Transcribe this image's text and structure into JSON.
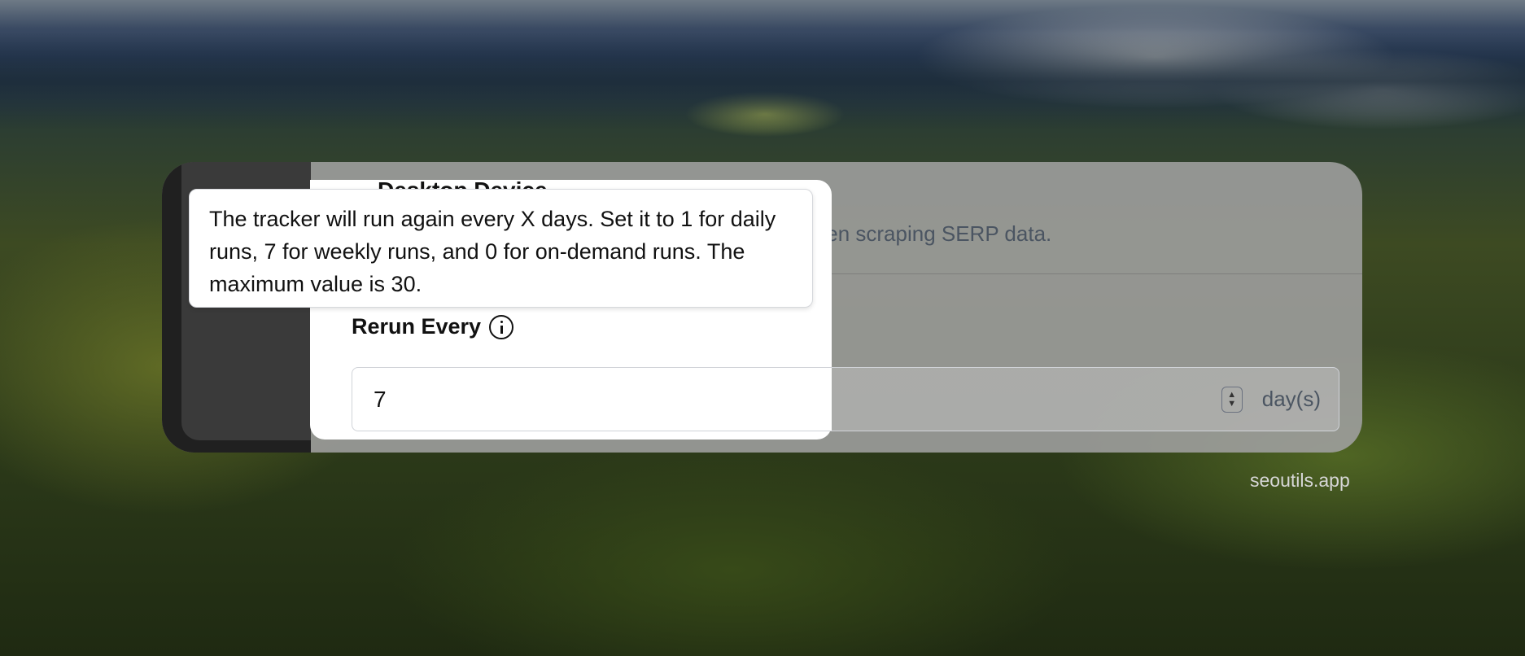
{
  "background": {
    "description_icon": "forest-landscape-image"
  },
  "card": {
    "partial_title": "Desktop Device",
    "description_tail": "when scraping SERP data."
  },
  "field": {
    "label": "Rerun Every",
    "value": "7",
    "unit": "day(s)"
  },
  "tooltip": {
    "text": "The tracker will run again every X days. Set it to 1 for daily runs, 7 for weekly runs, and 0 for on-demand runs. The maximum value is 30."
  },
  "footer": {
    "brand": "seoutils.app"
  },
  "colors": {
    "overlay": "#a0a0a0",
    "tooltip_bg": "#ffffff",
    "muted_text": "#4b5562"
  }
}
